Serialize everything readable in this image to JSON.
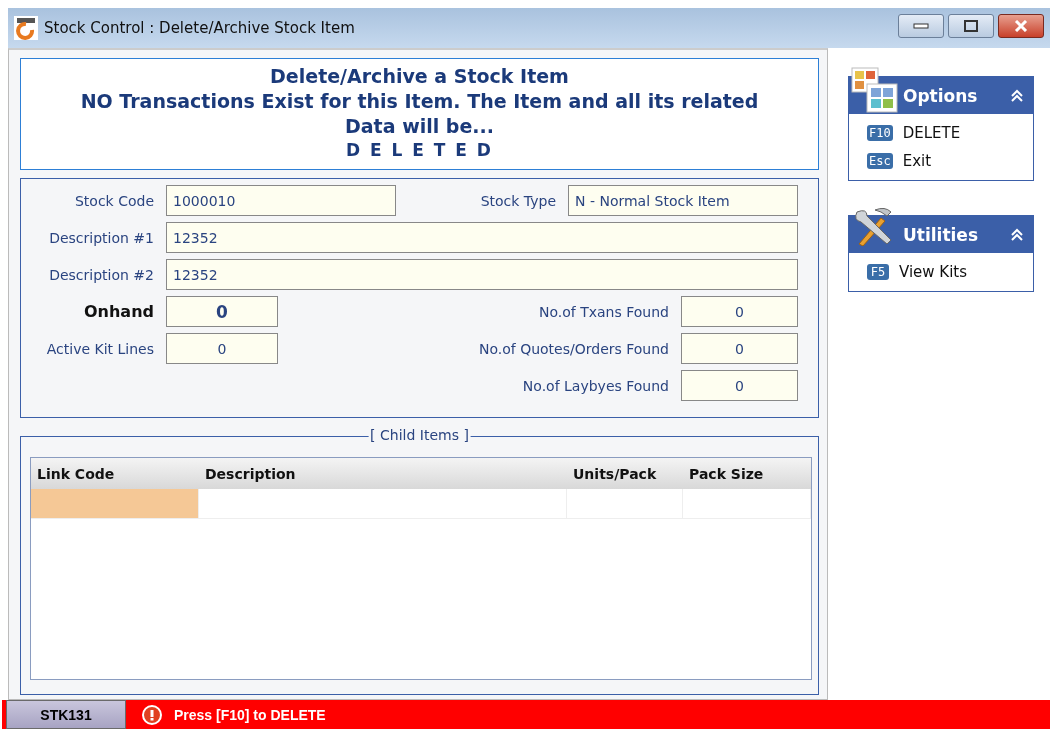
{
  "window": {
    "title": "Stock Control : Delete/Archive Stock Item"
  },
  "header": {
    "title": "Delete/Archive a Stock Item",
    "message": "NO Transactions Exist for this Item. The Item and all its related Data will be...",
    "action": "D E L E T E D"
  },
  "fields": {
    "stock_code": {
      "label": "Stock Code",
      "value": "1000010"
    },
    "stock_type": {
      "label": "Stock Type",
      "value": "N - Normal Stock Item"
    },
    "description_1": {
      "label": "Description #1",
      "value": "12352"
    },
    "description_2": {
      "label": "Description #2",
      "value": "12352"
    },
    "onhand": {
      "label": "Onhand",
      "value": "0"
    },
    "active_kit_lines": {
      "label": "Active Kit Lines",
      "value": "0"
    },
    "txans_found": {
      "label": "No.of Txans Found",
      "value": "0"
    },
    "quotes_orders_found": {
      "label": "No.of Quotes/Orders Found",
      "value": "0"
    },
    "laybyes_found": {
      "label": "No.of Laybyes Found",
      "value": "0"
    }
  },
  "child_items": {
    "title": "[ Child Items ]",
    "columns": [
      {
        "label": "Link Code",
        "selected": true
      },
      {
        "label": "Description",
        "selected": false
      },
      {
        "label": "Units/Pack",
        "selected": false
      },
      {
        "label": "Pack Size",
        "selected": false
      }
    ]
  },
  "sidebar": [
    {
      "title": "Options",
      "kind": "options",
      "expanded": true,
      "items": [
        {
          "key": "F10",
          "label": "DELETE"
        },
        {
          "key": "Esc",
          "label": "Exit"
        }
      ]
    },
    {
      "title": "Utilities",
      "kind": "utilities",
      "expanded": true,
      "items": [
        {
          "key": "F5",
          "label": "View Kits"
        }
      ]
    }
  ],
  "status_bar": {
    "code": "STK131",
    "message": "Press [F10] to DELETE"
  }
}
